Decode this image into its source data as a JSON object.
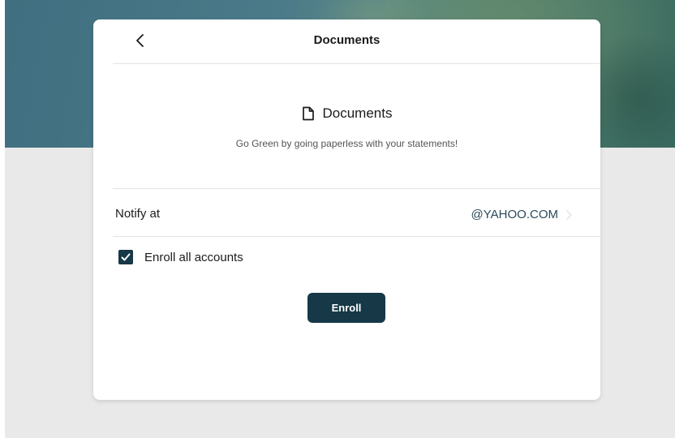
{
  "header": {
    "title": "Documents",
    "back_icon": "chevron-left-icon"
  },
  "intro": {
    "icon": "document-icon",
    "title": "Documents",
    "subtitle": "Go Green by going paperless with your statements!"
  },
  "notify": {
    "label": "Notify at",
    "value": "@YAHOO.COM",
    "chevron_icon": "chevron-right-icon"
  },
  "enroll_all": {
    "checked": true,
    "label": "Enroll all accounts"
  },
  "actions": {
    "enroll_label": "Enroll"
  },
  "colors": {
    "accent": "#163847",
    "backdrop": "#e9e9e9",
    "hero": "#4b7a89"
  }
}
